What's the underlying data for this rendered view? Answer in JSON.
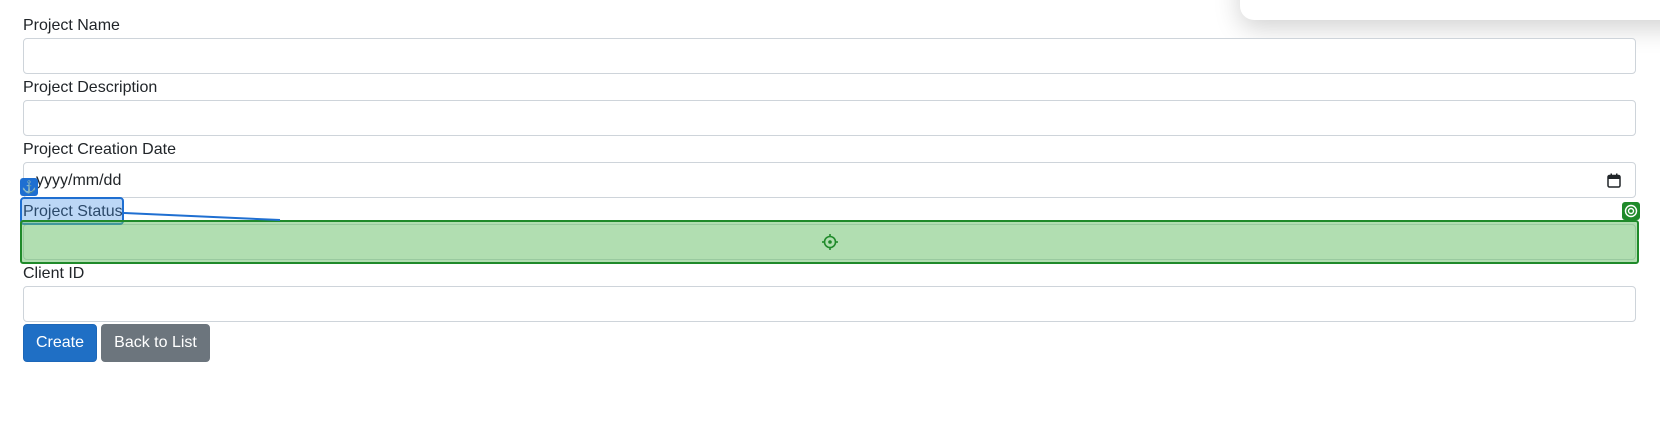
{
  "form": {
    "fields": [
      {
        "label": "Project Name",
        "value": ""
      },
      {
        "label": "Project Description",
        "value": ""
      },
      {
        "label": "Project Creation Date",
        "placeholder": "yyyy/mm/dd"
      },
      {
        "label": "Project Status",
        "value": ""
      },
      {
        "label": "Client ID",
        "value": ""
      }
    ],
    "buttons": {
      "create_label": "Create",
      "back_label": "Back to List"
    }
  },
  "icons": {
    "calendar": "calendar-icon",
    "anchor": "anchor-icon",
    "target": "target-icon",
    "crosshair": "crosshair-icon"
  },
  "colors": {
    "primary": "#1f6fc5",
    "secondary": "#6c757d",
    "highlight_blue": "#1f6fd1",
    "highlight_green": "#1f8a2a"
  }
}
